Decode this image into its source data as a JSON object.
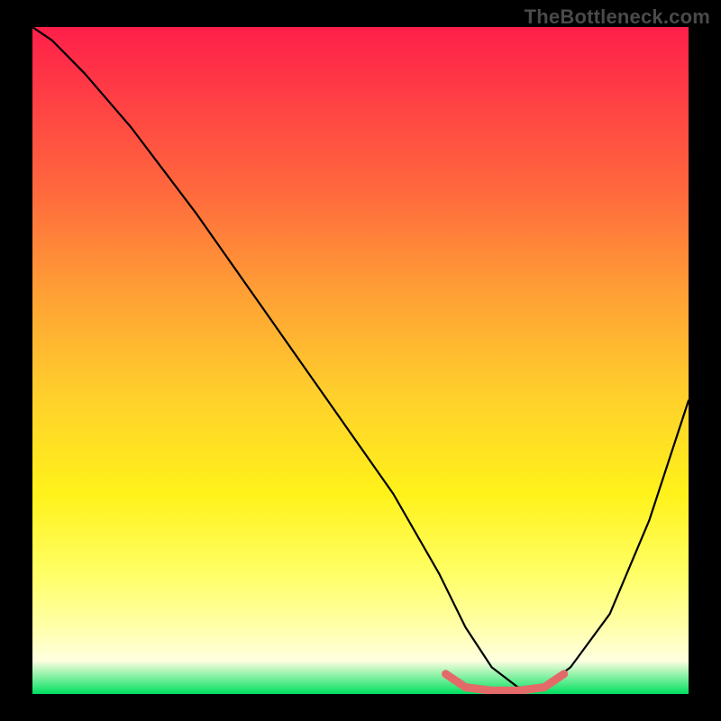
{
  "watermark": "TheBottleneck.com",
  "chart_data": {
    "type": "line",
    "title": "",
    "xlabel": "",
    "ylabel": "",
    "xlim": [
      0,
      100
    ],
    "ylim": [
      0,
      100
    ],
    "background_gradient": {
      "top": "#ff1f4a",
      "upper_mid": "#ffa035",
      "mid": "#ffff33",
      "lower": "#ffffcc",
      "bottom": "#00e060"
    },
    "series": [
      {
        "name": "bottleneck-curve",
        "color": "#000000",
        "x": [
          0,
          3,
          8,
          15,
          25,
          35,
          45,
          55,
          62,
          66,
          70,
          74,
          78,
          82,
          88,
          94,
          100
        ],
        "y": [
          100,
          98,
          93,
          85,
          72,
          58,
          44,
          30,
          18,
          10,
          4,
          1,
          1,
          4,
          12,
          26,
          44
        ]
      },
      {
        "name": "sweet-spot-highlight",
        "color": "#e46a6a",
        "x": [
          63,
          66,
          70,
          74,
          78,
          81
        ],
        "y": [
          3,
          1,
          0.5,
          0.5,
          1,
          3
        ]
      }
    ],
    "annotations": []
  }
}
